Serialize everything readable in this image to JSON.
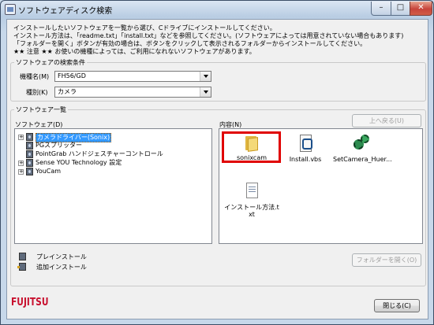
{
  "window": {
    "title": "ソフトウェアディスク検索",
    "min_glyph": "–",
    "max_glyph": "□",
    "close_glyph": "✕"
  },
  "description": [
    "インストールしたいソフトウェアを一覧から選び、Cドライブにインストールしてください。",
    "インストール方法は、「readme.txt」「install.txt」などを参照してください。(ソフトウェアによっては用意されていない場合もあります)",
    "「フォルダーを開く」ボタンが有効の場合は、ボタンをクリックして表示されるフォルダーからインストールしてください。",
    "★★ 注意 ★★ お使いの機種によっては、ご利用になれないソフトウェアがあります。"
  ],
  "search_conditions": {
    "legend": "ソフトウェアの検索条件",
    "model_label": "機種名(M)",
    "model_value": "FH56/GD",
    "type_label": "種別(K)",
    "type_value": "カメラ"
  },
  "software_list": {
    "legend": "ソフトウェア一覧",
    "tree_label": "ソフトウェア(D)",
    "tree_items": [
      {
        "label": "カメラドライバー(Sonix)",
        "selected": true
      },
      {
        "label": "PGスプリッター",
        "selected": false
      },
      {
        "label": "PointGrab ハンドジェスチャーコントロール",
        "selected": false
      },
      {
        "label": "Sense YOU Technology 設定",
        "selected": false
      },
      {
        "label": "YouCam",
        "selected": false
      }
    ],
    "content_label": "内容(N)",
    "up_button": "上へ戻る(U)",
    "files": [
      {
        "name": "sonixcam",
        "icon": "folder-icon"
      },
      {
        "name": "Install.vbs",
        "icon": "script-icon"
      },
      {
        "name": "SetCamera_Huer...",
        "icon": "gear-icon"
      },
      {
        "name": "インストール方法.txt",
        "icon": "text-file-icon"
      }
    ],
    "legend_items": [
      {
        "label": "プレインストール",
        "icon": "cd-icon"
      },
      {
        "label": "追加インストール",
        "icon": "cd-add-icon"
      }
    ],
    "open_folder_button": "フォルダーを開く(O)"
  },
  "footer": {
    "brand": "FUJITSU",
    "close_button": "閉じる(C)"
  },
  "colors": {
    "highlight": "#e00000",
    "selection": "#3399ff",
    "brand": "#c8102e"
  }
}
